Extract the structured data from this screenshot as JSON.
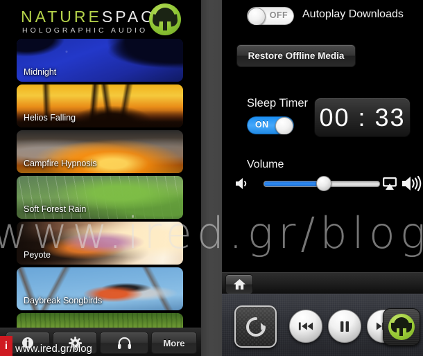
{
  "brand": {
    "word_nature": "NATURE",
    "word_space": "SPACE",
    "tagline": "HOLOGRAPHIC AUDIO",
    "logo_icon": "naturespace-mushroom-logo-icon",
    "accent_green": "#9ccc38"
  },
  "tracks": [
    {
      "title": "Midnight",
      "art": "art-midnight"
    },
    {
      "title": "Helios Falling",
      "art": "art-helios"
    },
    {
      "title": "Campfire Hypnosis",
      "art": "art-campfire"
    },
    {
      "title": "Soft Forest Rain",
      "art": "art-rain"
    },
    {
      "title": "Peyote",
      "art": "art-peyote"
    },
    {
      "title": "Daybreak Songbirds",
      "art": "art-songbirds"
    },
    {
      "title": "",
      "art": "art-grass"
    }
  ],
  "tabbar": {
    "items": [
      {
        "label": "",
        "icon": "info-icon"
      },
      {
        "label": "",
        "icon": "gear-icon"
      },
      {
        "label": "",
        "icon": "headphones-icon"
      },
      {
        "label": "More",
        "icon": "more-icon"
      }
    ]
  },
  "divider": {
    "icon": "arrow-right-icon"
  },
  "settings": {
    "autoplay": {
      "label": "Autoplay Downloads",
      "switch_state": "OFF",
      "switch_on": false
    },
    "restore_button": "Restore Offline Media",
    "sleep_timer": {
      "label": "Sleep Timer",
      "switch_state": "ON",
      "switch_on": true,
      "time": "00 : 33",
      "minutes": "00",
      "seconds": "33"
    },
    "volume": {
      "label": "Volume",
      "level_percent": 52,
      "mute_icon": "speaker-low-icon",
      "airplay_icon": "airplay-icon",
      "max_icon": "speaker-high-icon"
    }
  },
  "homebar": {
    "home_icon": "home-icon"
  },
  "transport": {
    "loop_icon": "loop-repeat-icon",
    "prev_icon": "previous-track-icon",
    "playpause_icon": "pause-icon",
    "next_icon": "next-track-icon",
    "app_icon": "naturespace-app-icon"
  },
  "watermark": {
    "text": "www.ired.gr/blog",
    "badge": "i",
    "url": "www.ired.gr/blog"
  }
}
